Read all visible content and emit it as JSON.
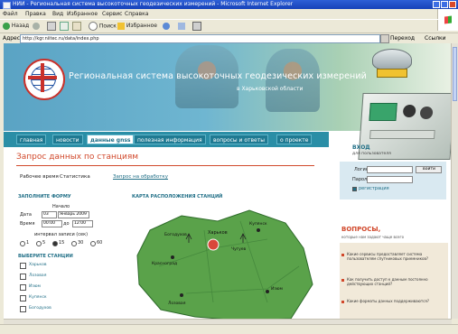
{
  "browser": {
    "title": "НИИ - Региональная система высокоточных геодезических измерений - Microsoft Internet Explorer",
    "menu": [
      "Файл",
      "Правка",
      "Вид",
      "Избранное",
      "Сервис",
      "Справка"
    ],
    "toolbar": {
      "back": "Назад",
      "search": "Поиск",
      "favorites": "Избранное"
    },
    "address_label": "Адрес",
    "address_value": "http://kgr.niitec.ru/data/index.php",
    "go_label": "Переход",
    "links_label": "Ссылки"
  },
  "site": {
    "title": "Региональная система высокоточных геодезических измерений",
    "subtitle": "в Харьковской области"
  },
  "nav": [
    "главная",
    "новости",
    "данные gnss",
    "полезная информация",
    "вопросы и ответы",
    "о проекте"
  ],
  "nav_active_index": 2,
  "page": {
    "title": "Запрос данных по станциям",
    "subtabs": [
      "Рабочее время",
      "Статистика",
      "Запрос на обработку"
    ],
    "form": {
      "title": "ЗАПОЛНИТЕ ФОРМУ",
      "period_label": "Начало",
      "date_label": "Дата",
      "date_day": "03",
      "date_month": "Январь 2009",
      "time_label": "Время",
      "time_from": "00:00",
      "time_to_label": "до",
      "time_to": "12:00",
      "interval_label": "интервал записи (сек)",
      "interval_options": [
        "1",
        "5",
        "15",
        "30",
        "60"
      ],
      "interval_selected": 2,
      "stations_title": "ВЫБЕРИТЕ СТАНЦИИ",
      "stations": [
        "Харьков",
        "Лозовая",
        "Изюм",
        "Купянск",
        "Богодухов"
      ]
    },
    "map": {
      "title": "КАРТА РАСПОЛОЖЕНИЯ СТАНЦИЙ",
      "region_color": "#5aa24a",
      "highlight_color": "#d9483b",
      "labels": [
        "Харьков",
        "Богодухов",
        "Купянск",
        "Изюм",
        "Лозовая",
        "Красноград",
        "Чугуев"
      ]
    }
  },
  "login": {
    "title": "ВХОД",
    "subtitle": "для пользователя",
    "login_label": "Логин",
    "password_label": "Пароль",
    "submit_label": "войти",
    "register_label": "регистрация"
  },
  "questions": {
    "title": "ВОПРОСЫ,",
    "subtitle": "которые нам задают чаще всего",
    "items": [
      "Какие сервисы предоставляет система пользователям спутниковых приемников?",
      "Как получить доступ к данным постоянно действующих станций?",
      "Какие форматы данных поддерживаются?"
    ]
  },
  "colors": {
    "accent": "#d1482b",
    "nav": "#2a8ea6",
    "link": "#1f6e86"
  },
  "icons": [
    "back-icon",
    "forward-icon",
    "stop-icon",
    "refresh-icon",
    "home-icon",
    "search-icon",
    "favorites-icon",
    "history-icon",
    "mail-icon",
    "print-icon"
  ]
}
